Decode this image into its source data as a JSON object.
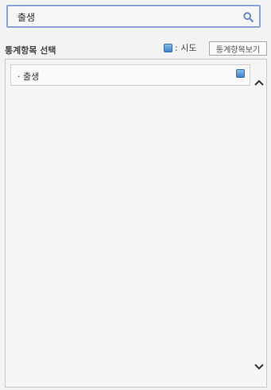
{
  "search": {
    "value": "출생",
    "icon": "search-icon"
  },
  "section": {
    "title": "통계항목 선택"
  },
  "legend": {
    "label": ": 시도",
    "color": "#4f8fd0"
  },
  "view_button": {
    "label": "통계항목보기"
  },
  "items": [
    {
      "label": "· 출생"
    }
  ],
  "colors": {
    "search_border": "#8da2d8",
    "swatch": "#4f8fd0"
  }
}
